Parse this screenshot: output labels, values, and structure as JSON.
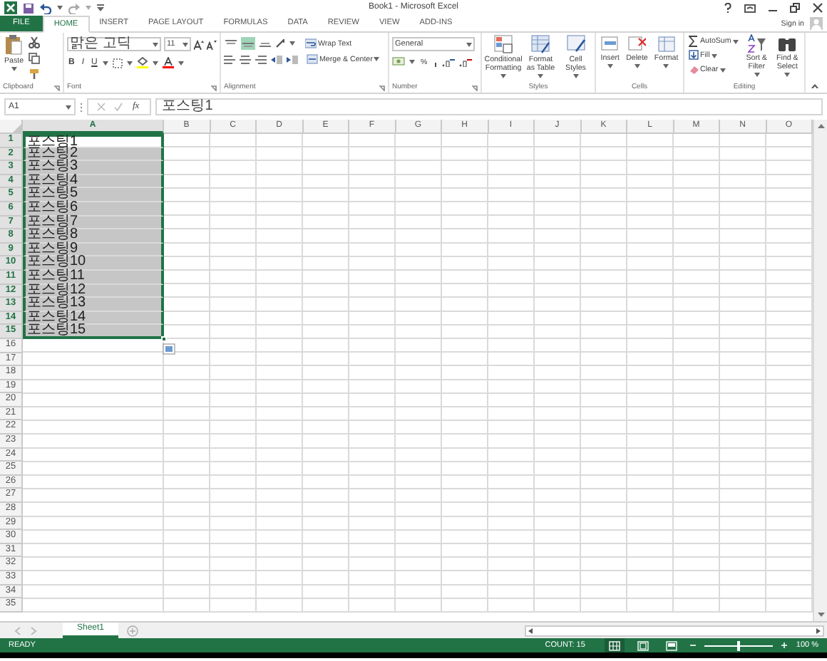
{
  "window": {
    "title": "Book1 - Microsoft Excel"
  },
  "ribbon_tabs": [
    {
      "label": "FILE",
      "kind": "file",
      "selected": false
    },
    {
      "label": "HOME",
      "kind": "tab",
      "selected": true
    },
    {
      "label": "INSERT",
      "kind": "tab",
      "selected": false
    },
    {
      "label": "PAGE LAYOUT",
      "kind": "tab",
      "selected": false
    },
    {
      "label": "FORMULAS",
      "kind": "tab",
      "selected": false
    },
    {
      "label": "DATA",
      "kind": "tab",
      "selected": false
    },
    {
      "label": "REVIEW",
      "kind": "tab",
      "selected": false
    },
    {
      "label": "VIEW",
      "kind": "tab",
      "selected": false
    },
    {
      "label": "ADD-INS",
      "kind": "tab",
      "selected": false
    }
  ],
  "account": {
    "label": "Sign in"
  },
  "ribbon": {
    "clipboard": {
      "label": "Clipboard",
      "paste": "Paste"
    },
    "font": {
      "label": "Font",
      "name": "맑은 고딕",
      "size": "11",
      "styles": [
        "B",
        "I",
        "U"
      ]
    },
    "alignment": {
      "label": "Alignment",
      "vertical_align": [
        {
          "selected": false
        },
        {
          "selected": true
        },
        {
          "selected": false
        }
      ],
      "wrap": "Wrap Text",
      "merge": "Merge & Center"
    },
    "number": {
      "label": "Number",
      "format": "General",
      "percent": "%"
    },
    "styles": {
      "label": "Styles",
      "buttons": [
        "Conditional Formatting",
        "Format as Table",
        "Cell Styles"
      ]
    },
    "cells": {
      "label": "Cells",
      "buttons": [
        "Insert",
        "Delete",
        "Format"
      ]
    },
    "editing": {
      "label": "Editing",
      "small": [
        "AutoSum",
        "Fill",
        "Clear"
      ],
      "large": [
        "Sort & Filter",
        "Find & Select"
      ]
    }
  },
  "formula_bar": {
    "name_box": "A1",
    "function_label": "fx",
    "value": "포스팅1"
  },
  "sheet": {
    "columns": [
      {
        "label": "A",
        "selected": true
      },
      {
        "label": "B",
        "selected": false
      },
      {
        "label": "C",
        "selected": false
      },
      {
        "label": "D",
        "selected": false
      },
      {
        "label": "E",
        "selected": false
      },
      {
        "label": "F",
        "selected": false
      },
      {
        "label": "G",
        "selected": false
      },
      {
        "label": "H",
        "selected": false
      },
      {
        "label": "I",
        "selected": false
      },
      {
        "label": "J",
        "selected": false
      },
      {
        "label": "K",
        "selected": false
      },
      {
        "label": "L",
        "selected": false
      },
      {
        "label": "M",
        "selected": false
      },
      {
        "label": "N",
        "selected": false
      },
      {
        "label": "O",
        "selected": false
      }
    ],
    "rows": [
      {
        "number": "1",
        "selected": true,
        "value": "포스팅1",
        "active": true
      },
      {
        "number": "2",
        "selected": true,
        "value": "포스팅2",
        "active": false
      },
      {
        "number": "3",
        "selected": true,
        "value": "포스팅3",
        "active": false
      },
      {
        "number": "4",
        "selected": true,
        "value": "포스팅4",
        "active": false
      },
      {
        "number": "5",
        "selected": true,
        "value": "포스팅5",
        "active": false
      },
      {
        "number": "6",
        "selected": true,
        "value": "포스팅6",
        "active": false
      },
      {
        "number": "7",
        "selected": true,
        "value": "포스팅7",
        "active": false
      },
      {
        "number": "8",
        "selected": true,
        "value": "포스팅8",
        "active": false
      },
      {
        "number": "9",
        "selected": true,
        "value": "포스팅9",
        "active": false
      },
      {
        "number": "10",
        "selected": true,
        "value": "포스팅10",
        "active": false
      },
      {
        "number": "11",
        "selected": true,
        "value": "포스팅11",
        "active": false
      },
      {
        "number": "12",
        "selected": true,
        "value": "포스팅12",
        "active": false
      },
      {
        "number": "13",
        "selected": true,
        "value": "포스팅13",
        "active": false
      },
      {
        "number": "14",
        "selected": true,
        "value": "포스팅14",
        "active": false
      },
      {
        "number": "15",
        "selected": true,
        "value": "포스팅15",
        "active": false
      },
      {
        "number": "16",
        "selected": false
      },
      {
        "number": "17",
        "selected": false
      },
      {
        "number": "18",
        "selected": false
      },
      {
        "number": "19",
        "selected": false
      },
      {
        "number": "20",
        "selected": false
      },
      {
        "number": "21",
        "selected": false
      },
      {
        "number": "22",
        "selected": false
      },
      {
        "number": "23",
        "selected": false
      },
      {
        "number": "24",
        "selected": false
      },
      {
        "number": "25",
        "selected": false
      },
      {
        "number": "26",
        "selected": false
      },
      {
        "number": "27",
        "selected": false
      },
      {
        "number": "28",
        "selected": false
      },
      {
        "number": "29",
        "selected": false
      },
      {
        "number": "30",
        "selected": false
      },
      {
        "number": "31",
        "selected": false
      },
      {
        "number": "32",
        "selected": false
      },
      {
        "number": "33",
        "selected": false
      },
      {
        "number": "34",
        "selected": false
      },
      {
        "number": "35",
        "selected": false
      }
    ]
  },
  "sheet_tabs": [
    {
      "label": "Sheet1",
      "selected": true
    }
  ],
  "status_bar": {
    "status": "READY",
    "count": "COUNT: 15",
    "views": [
      {
        "selected": true
      },
      {
        "selected": false
      },
      {
        "selected": false
      }
    ],
    "zoom": {
      "level": 0.5,
      "reading": "100 %"
    }
  }
}
